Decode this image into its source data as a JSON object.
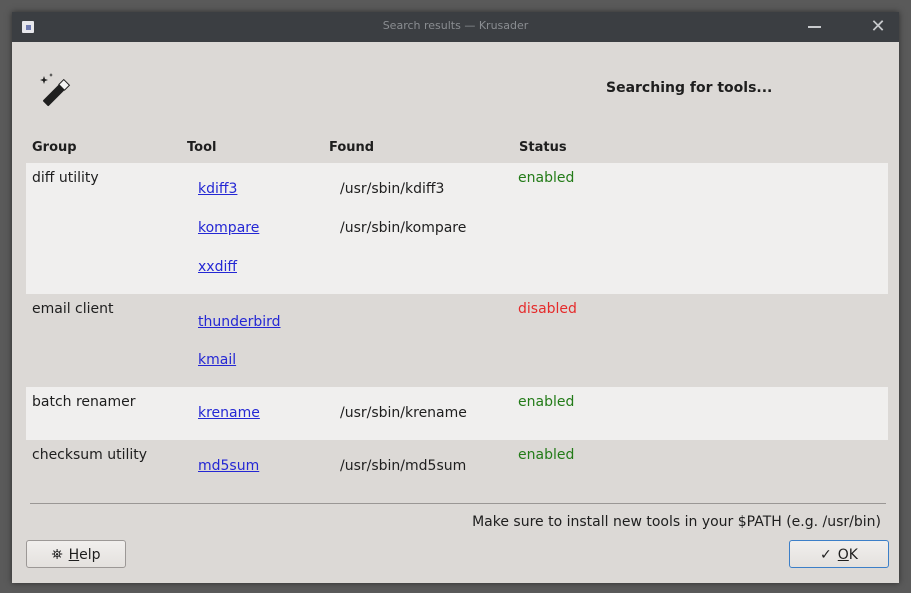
{
  "window": {
    "title": "Search results — Krusader",
    "close_glyph": "✕"
  },
  "header": {
    "status_text": "Searching for tools..."
  },
  "columns": {
    "group": "Group",
    "tool": "Tool",
    "found": "Found",
    "status": "Status"
  },
  "groups": [
    {
      "name": "diff utility",
      "status": "enabled",
      "tools": [
        {
          "name": "kdiff3",
          "found": "/usr/sbin/kdiff3"
        },
        {
          "name": "kompare",
          "found": "/usr/sbin/kompare"
        },
        {
          "name": "xxdiff",
          "found": ""
        }
      ]
    },
    {
      "name": "email client",
      "status": "disabled",
      "tools": [
        {
          "name": "thunderbird",
          "found": ""
        },
        {
          "name": "kmail",
          "found": ""
        }
      ]
    },
    {
      "name": "batch renamer",
      "status": "enabled",
      "tools": [
        {
          "name": "krename",
          "found": "/usr/sbin/krename"
        }
      ]
    },
    {
      "name": "checksum utility",
      "status": "enabled",
      "tools": [
        {
          "name": "md5sum",
          "found": "/usr/sbin/md5sum"
        }
      ]
    }
  ],
  "footer": {
    "hint": "Make sure to install new tools in your $PATH (e.g. /usr/bin)",
    "help_mnemonic": "H",
    "help_rest": "elp",
    "help_icon_glyph": "⛯",
    "ok_glyph": "✓",
    "ok_mnemonic": "O",
    "ok_rest": "K"
  },
  "colors": {
    "enabled": "#237b18",
    "disabled": "#e52b2b",
    "link": "#2427d4"
  }
}
